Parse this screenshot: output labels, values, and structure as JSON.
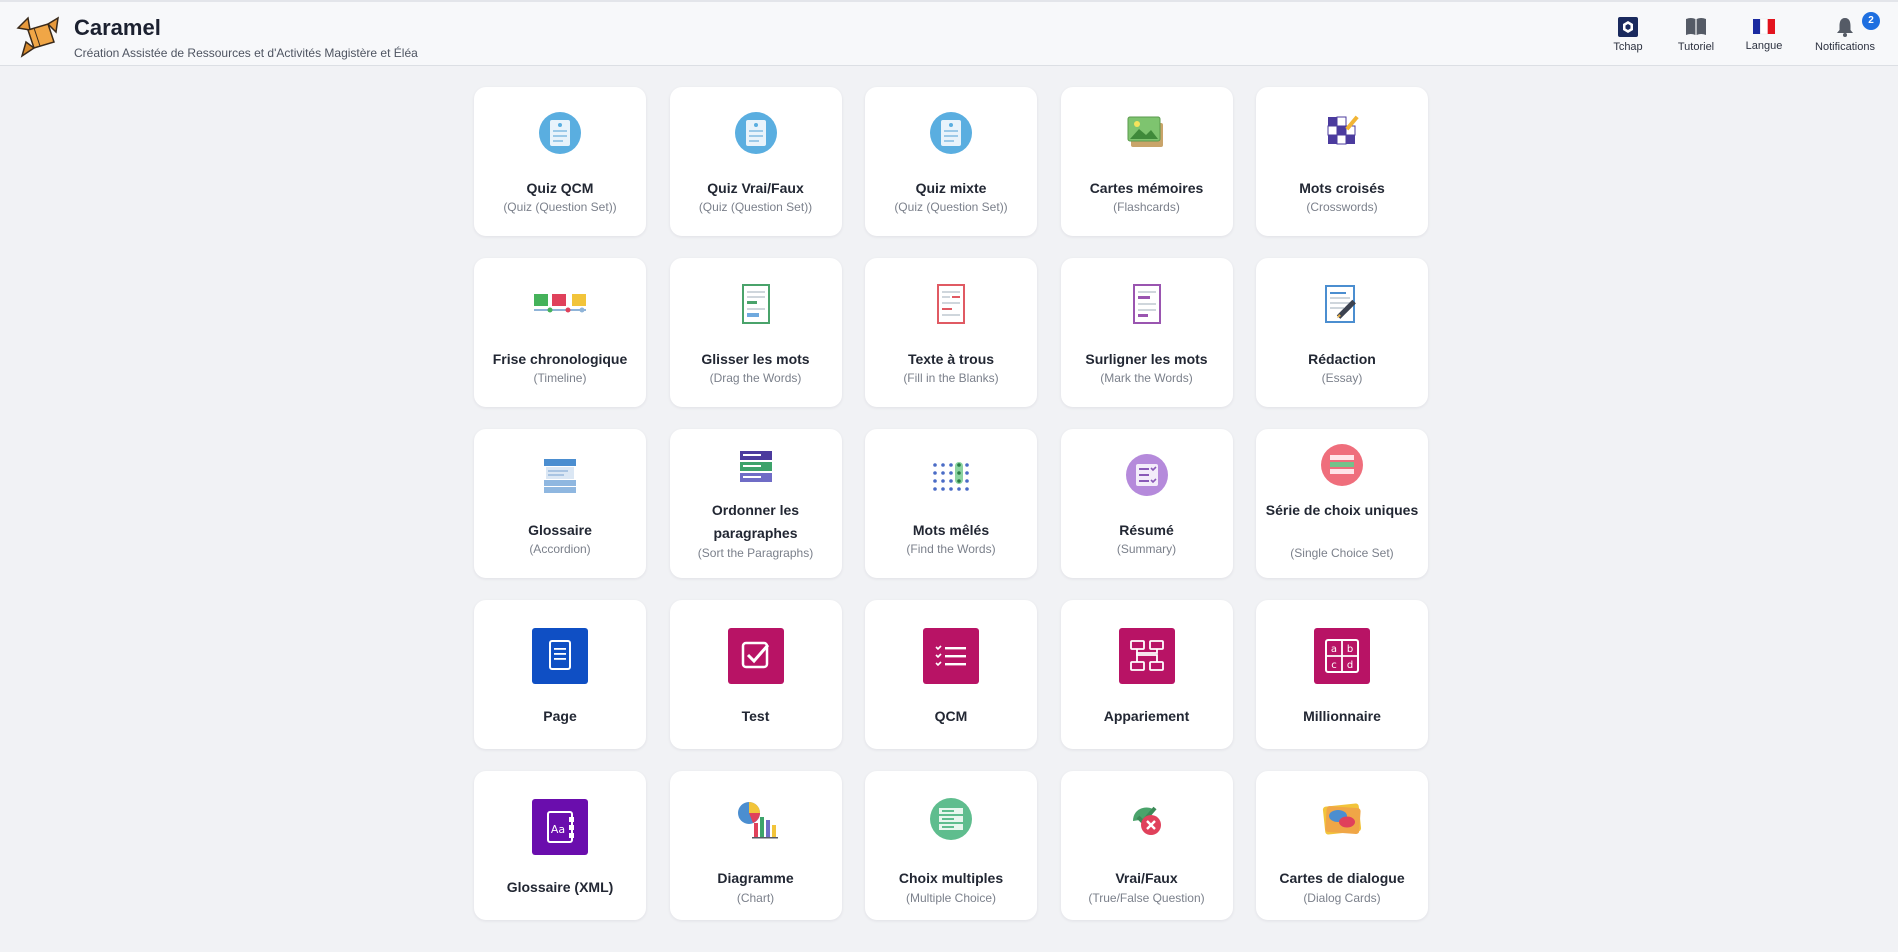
{
  "header": {
    "app_title": "Caramel",
    "app_subtitle": "Création Assistée de Ressources et d'Activités Magistère et Éléa",
    "nav": [
      {
        "label": "Tchap",
        "icon": "tchap-icon"
      },
      {
        "label": "Tutoriel",
        "icon": "book-icon"
      },
      {
        "label": "Langue",
        "icon": "french-flag-icon"
      },
      {
        "label": "Notifications",
        "icon": "bell-icon"
      }
    ],
    "notification_count": "2"
  },
  "activities": [
    {
      "title": "Quiz QCM",
      "subtitle": "(Quiz (Question Set))",
      "icon": "quiz-icon"
    },
    {
      "title": "Quiz Vrai/Faux",
      "subtitle": "(Quiz (Question Set))",
      "icon": "quiz-icon"
    },
    {
      "title": "Quiz mixte",
      "subtitle": "(Quiz (Question Set))",
      "icon": "quiz-icon"
    },
    {
      "title": "Cartes mémoires",
      "subtitle": "(Flashcards)",
      "icon": "flashcards-icon"
    },
    {
      "title": "Mots croisés",
      "subtitle": "(Crosswords)",
      "icon": "crosswords-icon"
    },
    {
      "title": "Frise chronologique",
      "subtitle": "(Timeline)",
      "icon": "timeline-icon"
    },
    {
      "title": "Glisser les mots",
      "subtitle": "(Drag the Words)",
      "icon": "drag-words-icon"
    },
    {
      "title": "Texte à trous",
      "subtitle": "(Fill in the Blanks)",
      "icon": "fill-blanks-icon"
    },
    {
      "title": "Surligner les mots",
      "subtitle": "(Mark the Words)",
      "icon": "mark-words-icon"
    },
    {
      "title": "Rédaction",
      "subtitle": "(Essay)",
      "icon": "essay-icon"
    },
    {
      "title": "Glossaire",
      "subtitle": "(Accordion)",
      "icon": "accordion-icon"
    },
    {
      "title": "Ordonner les paragraphes",
      "subtitle": "(Sort the Paragraphs)",
      "icon": "sort-paragraphs-icon"
    },
    {
      "title": "Mots mêlés",
      "subtitle": "(Find the Words)",
      "icon": "find-words-icon"
    },
    {
      "title": "Résumé",
      "subtitle": "(Summary)",
      "icon": "summary-icon"
    },
    {
      "title": "Série de choix uniques",
      "subtitle": "(Single Choice Set)",
      "icon": "single-choice-icon"
    },
    {
      "title": "Page",
      "subtitle": "",
      "icon": "page-icon",
      "color": "#0f4fc4"
    },
    {
      "title": "Test",
      "subtitle": "",
      "icon": "test-icon",
      "color": "#b81365"
    },
    {
      "title": "QCM",
      "subtitle": "",
      "icon": "qcm-icon",
      "color": "#b81365"
    },
    {
      "title": "Appariement",
      "subtitle": "",
      "icon": "matching-icon",
      "color": "#b81365"
    },
    {
      "title": "Millionnaire",
      "subtitle": "",
      "icon": "millionaire-icon",
      "color": "#b81365"
    },
    {
      "title": "Glossaire (XML)",
      "subtitle": "",
      "icon": "glossary-xml-icon",
      "color": "#6a0dad"
    },
    {
      "title": "Diagramme",
      "subtitle": "(Chart)",
      "icon": "chart-icon"
    },
    {
      "title": "Choix multiples",
      "subtitle": "(Multiple Choice)",
      "icon": "multiple-choice-icon"
    },
    {
      "title": "Vrai/Faux",
      "subtitle": "(True/False Question)",
      "icon": "true-false-icon"
    },
    {
      "title": "Cartes de dialogue",
      "subtitle": "(Dialog Cards)",
      "icon": "dialog-cards-icon"
    }
  ]
}
